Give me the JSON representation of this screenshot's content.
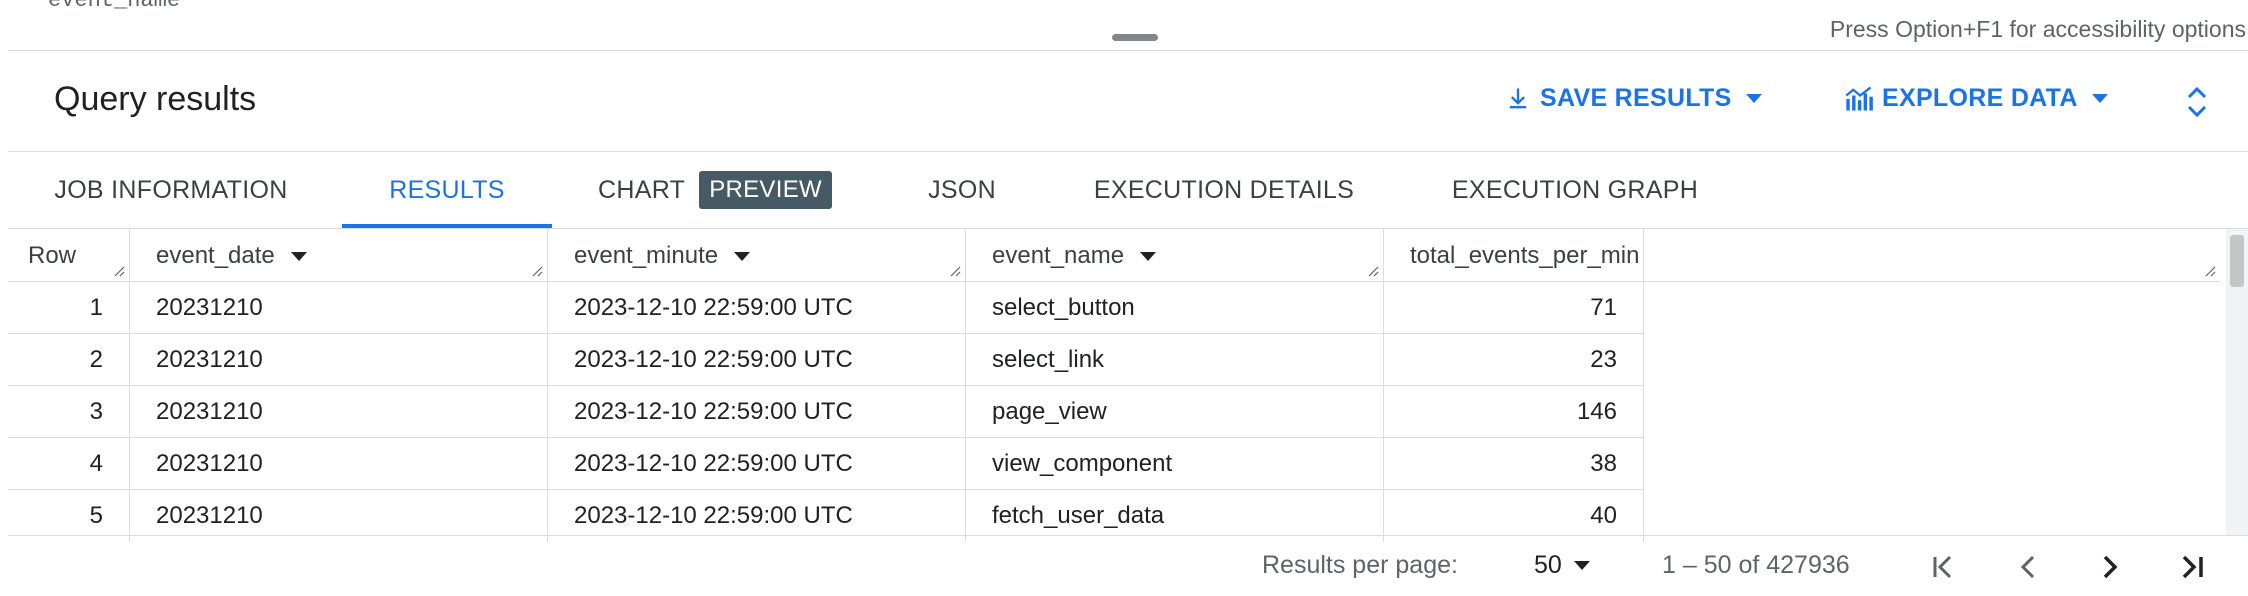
{
  "editor": {
    "code_fragment": "event_name"
  },
  "accessibility_hint": "Press Option+F1 for accessibility options",
  "header": {
    "title": "Query results",
    "save_results_label": "SAVE RESULTS",
    "explore_data_label": "EXPLORE DATA"
  },
  "tabs": [
    {
      "label": "JOB INFORMATION",
      "active": false
    },
    {
      "label": "RESULTS",
      "active": true
    },
    {
      "label": "CHART",
      "badge": "PREVIEW",
      "active": false
    },
    {
      "label": "JSON",
      "active": false
    },
    {
      "label": "EXECUTION DETAILS",
      "active": false
    },
    {
      "label": "EXECUTION GRAPH",
      "active": false
    }
  ],
  "table": {
    "columns": [
      "Row",
      "event_date",
      "event_minute",
      "event_name",
      "total_events_per_min"
    ],
    "rows": [
      {
        "row": "1",
        "event_date": "20231210",
        "event_minute": "2023-12-10 22:59:00 UTC",
        "event_name": "select_button",
        "total": "71"
      },
      {
        "row": "2",
        "event_date": "20231210",
        "event_minute": "2023-12-10 22:59:00 UTC",
        "event_name": "select_link",
        "total": "23"
      },
      {
        "row": "3",
        "event_date": "20231210",
        "event_minute": "2023-12-10 22:59:00 UTC",
        "event_name": "page_view",
        "total": "146"
      },
      {
        "row": "4",
        "event_date": "20231210",
        "event_minute": "2023-12-10 22:59:00 UTC",
        "event_name": "view_component",
        "total": "38"
      },
      {
        "row": "5",
        "event_date": "20231210",
        "event_minute": "2023-12-10 22:59:00 UTC",
        "event_name": "fetch_user_data",
        "total": "40"
      }
    ]
  },
  "pagination": {
    "results_per_page_label": "Results per page:",
    "results_per_page_value": "50",
    "range_text": "1 – 50 of 427936"
  },
  "colors": {
    "accent": "#1a73e8",
    "badge_bg": "#455a64",
    "text": "#202124",
    "muted": "#5f6368",
    "border": "#dadce0"
  },
  "icons": [
    "download-icon",
    "explore-chart-icon",
    "expand-collapse-icon",
    "sort-arrow-icon",
    "first-page-icon",
    "previous-page-icon",
    "next-page-icon",
    "last-page-icon"
  ]
}
